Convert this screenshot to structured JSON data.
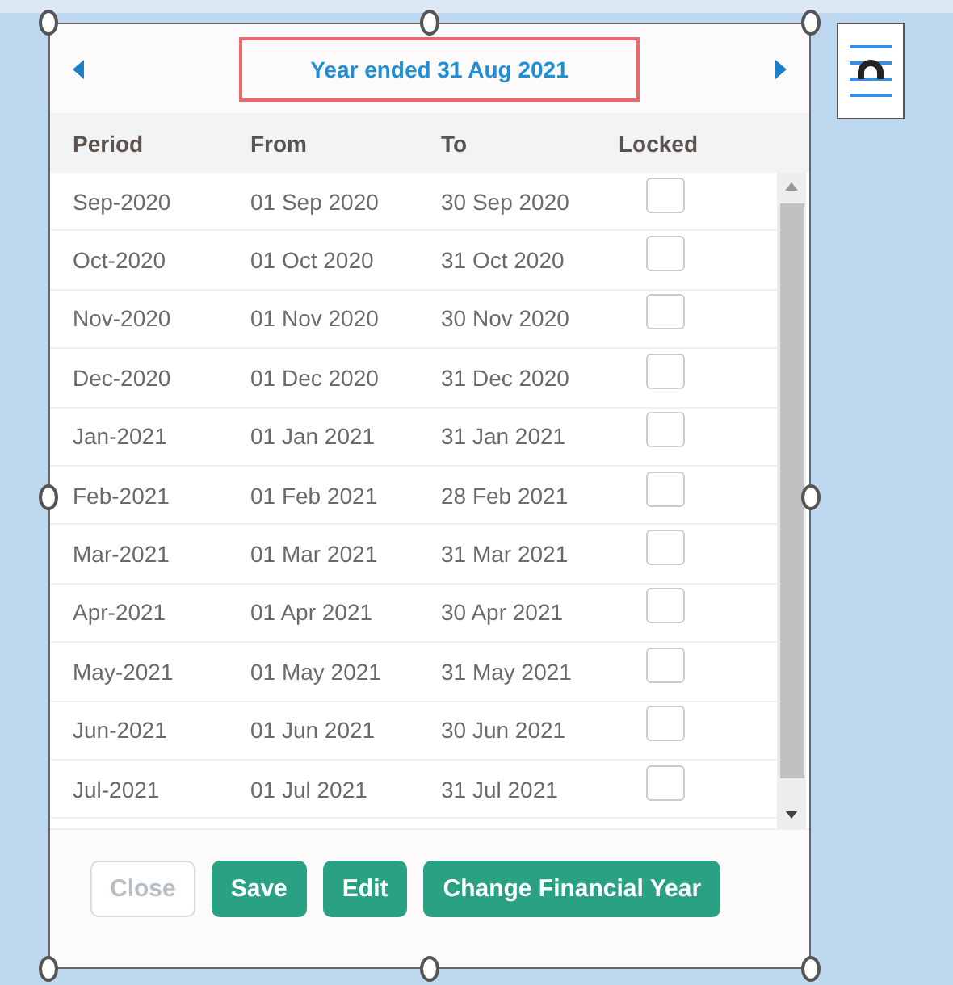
{
  "header": {
    "title": "Year ended 31 Aug 2021"
  },
  "table": {
    "columns": [
      "Period",
      "From",
      "To",
      "Locked"
    ],
    "rows": [
      {
        "period": "Sep-2020",
        "from": "01 Sep 2020",
        "to": "30 Sep 2020",
        "locked": false
      },
      {
        "period": "Oct-2020",
        "from": "01 Oct 2020",
        "to": "31 Oct 2020",
        "locked": false
      },
      {
        "period": "Nov-2020",
        "from": "01 Nov 2020",
        "to": "30 Nov 2020",
        "locked": false
      },
      {
        "period": "Dec-2020",
        "from": "01 Dec 2020",
        "to": "31 Dec 2020",
        "locked": false
      },
      {
        "period": "Jan-2021",
        "from": "01 Jan 2021",
        "to": "31 Jan 2021",
        "locked": false
      },
      {
        "period": "Feb-2021",
        "from": "01 Feb 2021",
        "to": "28 Feb 2021",
        "locked": false
      },
      {
        "period": "Mar-2021",
        "from": "01 Mar 2021",
        "to": "31 Mar 2021",
        "locked": false
      },
      {
        "period": "Apr-2021",
        "from": "01 Apr 2021",
        "to": "30 Apr 2021",
        "locked": false
      },
      {
        "period": "May-2021",
        "from": "01 May 2021",
        "to": "31 May 2021",
        "locked": false
      },
      {
        "period": "Jun-2021",
        "from": "01 Jun 2021",
        "to": "30 Jun 2021",
        "locked": false
      },
      {
        "period": "Jul-2021",
        "from": "01 Jul 2021",
        "to": "31 Jul 2021",
        "locked": false
      }
    ]
  },
  "buttons": [
    {
      "label": "Close",
      "disabled": true
    },
    {
      "label": "Save",
      "disabled": false
    },
    {
      "label": "Edit",
      "disabled": false
    },
    {
      "label": "Change Financial Year",
      "disabled": false
    }
  ]
}
